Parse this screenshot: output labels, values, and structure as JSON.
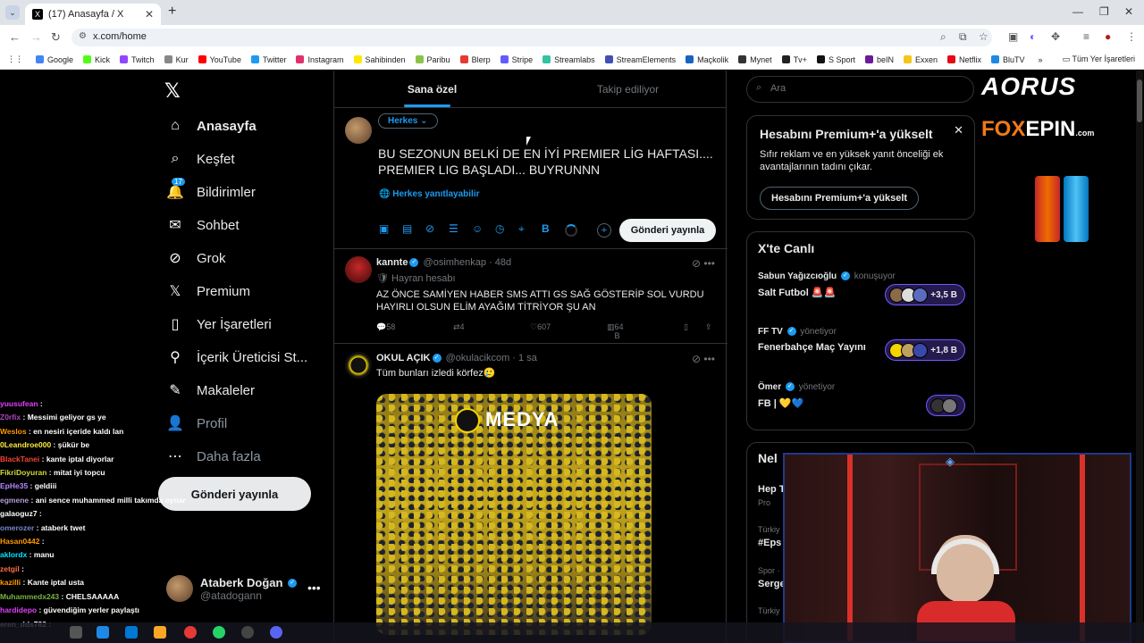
{
  "browser": {
    "tab_title": "(17) Anasayfa / X",
    "url": "x.com/home",
    "bookmarks": [
      "Google",
      "Kick",
      "Twitch",
      "Kur",
      "YouTube",
      "Twitter",
      "Instagram",
      "Sahibinden",
      "Paribu",
      "Blerp",
      "Stripe",
      "Streamlabs",
      "StreamElements",
      "Maçkolik",
      "Mynet",
      "Tv+",
      "S Sport",
      "beIN",
      "Exxen",
      "Netflix",
      "BluTV"
    ],
    "bookmark_colors": [
      "#4285f4",
      "#53fc18",
      "#9146ff",
      "#888888",
      "#ff0000",
      "#1d9bf0",
      "#e1306c",
      "#ffe800",
      "#8bc34a",
      "#e53935",
      "#635bff",
      "#31c3a2",
      "#3f51b5",
      "#1565c0",
      "#333333",
      "#222222",
      "#111111",
      "#6a1b9a",
      "#f5c518",
      "#e50914",
      "#1e88e5"
    ],
    "all_bookmarks": "Tüm Yer İşaretleri"
  },
  "nav": {
    "items": [
      {
        "label": "Anasayfa",
        "icon": "home-icon",
        "glyph": "⌂"
      },
      {
        "label": "Keşfet",
        "icon": "search-icon",
        "glyph": "⌕"
      },
      {
        "label": "Bildirimler",
        "icon": "bell-icon",
        "glyph": "🔔"
      },
      {
        "label": "Sohbet",
        "icon": "mail-icon",
        "glyph": "✉"
      },
      {
        "label": "Grok",
        "icon": "grok-icon",
        "glyph": "⊘"
      },
      {
        "label": "Premium",
        "icon": "x-logo-icon",
        "glyph": "𝕏"
      },
      {
        "label": "Yer İşaretleri",
        "icon": "bookmark-icon",
        "glyph": "▯"
      },
      {
        "label": "İçerik Üreticisi St...",
        "icon": "creator-icon",
        "glyph": "⚲"
      },
      {
        "label": "Makaleler",
        "icon": "article-icon",
        "glyph": "✎"
      },
      {
        "label": "Profil",
        "icon": "profile-icon",
        "glyph": "👤"
      },
      {
        "label": "Daha fazla",
        "icon": "more-icon",
        "glyph": "⋯"
      }
    ],
    "notification_count": "17",
    "post_button": "Gönderi yayınla"
  },
  "account": {
    "name": "Ataberk Doğan",
    "handle": "@atadogann"
  },
  "chat": [
    {
      "user": "yuusufean",
      "msg": "",
      "color": "#e040fb"
    },
    {
      "user": "Z0rfix",
      "msg": "Messimi geliyor gs ye",
      "color": "#ab47bc"
    },
    {
      "user": "Weslos",
      "msg": "en nesiri içeride kaldı lan",
      "color": "#ff9800"
    },
    {
      "user": "0Leandroe000",
      "msg": "şükür be",
      "color": "#ffeb3b"
    },
    {
      "user": "BlackTanei",
      "msg": "kante iptal diyorlar",
      "color": "#f44336"
    },
    {
      "user": "FikriDoyuran",
      "msg": "mitat iyi topcu",
      "color": "#cddc39"
    },
    {
      "user": "EpHe35",
      "msg": "geldiii",
      "color": "#b388ff"
    },
    {
      "user": "egmene",
      "msg": "ani sence muhammed milli takımda oynar mı",
      "color": "#b39ddb"
    },
    {
      "user": "galaoguz7",
      "msg": "",
      "color": "#ffffff"
    },
    {
      "user": "omerozer",
      "msg": "ataberk twet",
      "color": "#7986cb"
    },
    {
      "user": "Hasan0442",
      "msg": "",
      "color": "#ff9800"
    },
    {
      "user": "aklordx",
      "msg": "manu",
      "color": "#00e5ff"
    },
    {
      "user": "zetgil",
      "msg": "",
      "color": "#ff7043"
    },
    {
      "user": "kazilli",
      "msg": "Kante iptal usta",
      "color": "#ff9800"
    },
    {
      "user": "Muhammedx243",
      "msg": "CHELSAAAAA",
      "color": "#7cb342"
    },
    {
      "user": "hardidepo",
      "msg": "güvendiğim yerler paylaştı",
      "color": "#e040fb"
    },
    {
      "user": "eren_dds782",
      "msg": "",
      "color": "#ffffff"
    }
  ],
  "main": {
    "tabs": [
      "Sana özel",
      "Takip ediliyor"
    ],
    "compose": {
      "audience": "Herkes",
      "text_line1": "BU SEZONUN BELKİ DE EN İYİ PREMIER LİG HAFTASI....",
      "text_line2": "PREMIER LIG BAŞLADI... BUYRUNNN",
      "reply_setting": "Herkes yanıtlayabilir",
      "post_button": "Gönderi yayınla"
    },
    "tweets": [
      {
        "name": "kannte",
        "handle": "@osimhenkap · 48d",
        "sub": "Hayran hesabı",
        "body": "AZ ÖNCE SAMİYEN HABER SMS ATTI GS SAĞ GÖSTERİP SOL VURDU HAYIRLI OLSUN ELİM AYAĞIM TİTRİYOR ŞU AN",
        "replies": "58",
        "retweets": "4",
        "likes": "607",
        "views": "64 B"
      },
      {
        "name": "OKUL AÇIK",
        "handle": "@okulacikcom · 1 sa",
        "body": "Tüm bunları izledi körfez🥲",
        "media_logo": "MEDYA"
      }
    ]
  },
  "right": {
    "search_placeholder": "Ara",
    "premium": {
      "title": "Hesabını Premium+'a yükselt",
      "desc": "Sıfır reklam ve en yüksek yanıt önceliği ek avantajlarının tadını çıkar.",
      "button": "Hesabını Premium+'a yükselt"
    },
    "live": {
      "title": "X'te Canlı",
      "spaces": [
        {
          "host": "Sabun Yağızcıoğlu",
          "role": "konuşuyor",
          "title": "Salt Futbol 🚨🚨",
          "count": "+3,5 B"
        },
        {
          "host": "FF TV",
          "role": "yönetiyor",
          "title": "Fenerbahçe Maç Yayını",
          "count": "+1,8 B"
        },
        {
          "host": "Ömer",
          "role": "yönetiyor",
          "title": "FB | 💛💙",
          "count": ""
        }
      ]
    },
    "news": {
      "title": "Nel",
      "items": [
        {
          "title": "Hep T",
          "meta": "Pro"
        },
        {
          "meta": "Türkiy",
          "title": "#Eps"
        },
        {
          "meta": "Spor ·",
          "title": "Serge"
        },
        {
          "meta": "Türkiy",
          "title": ""
        }
      ]
    }
  },
  "overlay": {
    "aorus": "AORUS",
    "foxepin_fox": "FOX",
    "foxepin_rest": "EPIN",
    "foxepin_domain": ".com"
  }
}
